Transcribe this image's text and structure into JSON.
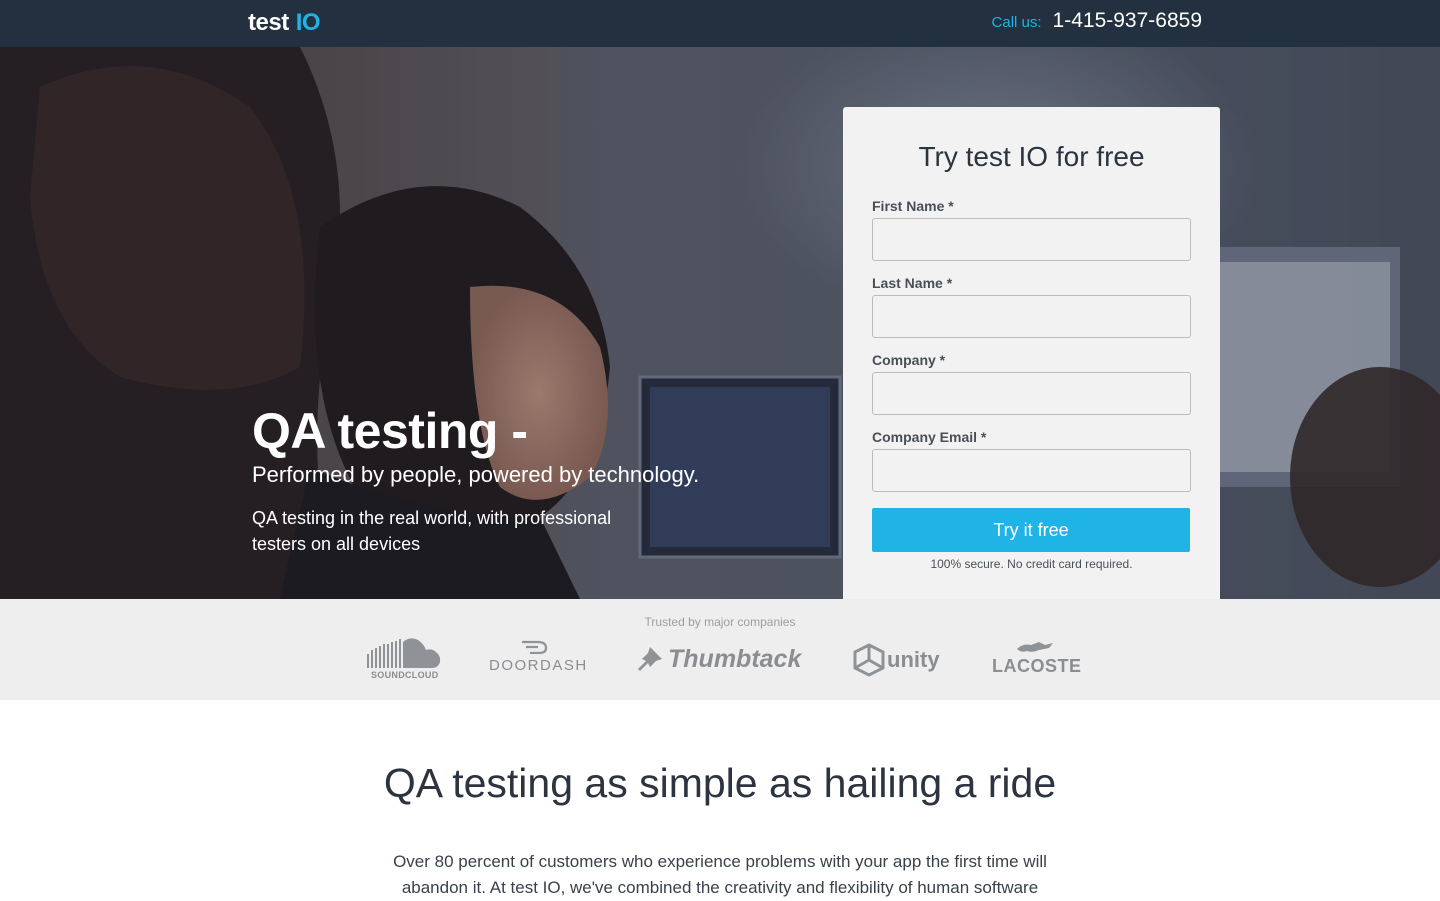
{
  "header": {
    "logo_text_main": "test",
    "logo_text_accent": "IO",
    "call_label": "Call us:",
    "phone": "1-415-937-6859"
  },
  "hero": {
    "title": "QA testing -",
    "subtitle": "Performed by people, powered by technology.",
    "description": "QA testing in the real world, with professional testers on all devices"
  },
  "form": {
    "title": "Try test IO for free",
    "fields": [
      {
        "label": "First Name *",
        "value": "",
        "placeholder": ""
      },
      {
        "label": "Last Name *",
        "value": "",
        "placeholder": ""
      },
      {
        "label": "Company *",
        "value": "",
        "placeholder": ""
      },
      {
        "label": "Company Email *",
        "value": "",
        "placeholder": ""
      }
    ],
    "submit_label": "Try it free",
    "secure_note": "100% secure. No credit card required."
  },
  "trusted": {
    "label": "Trusted by major companies",
    "logos": [
      {
        "name": "SOUNDCLOUD",
        "icon": "soundcloud-logo"
      },
      {
        "name": "DOORDASH",
        "icon": "doordash-logo"
      },
      {
        "name": "Thumbtack",
        "icon": "thumbtack-logo"
      },
      {
        "name": "unity",
        "icon": "unity-logo"
      },
      {
        "name": "LACOSTE",
        "icon": "lacoste-logo"
      }
    ]
  },
  "section": {
    "title": "QA testing as simple as hailing a ride",
    "body": "Over 80 percent of customers who experience problems with your app the first time will abandon it. At test IO, we've combined the creativity and flexibility of human software"
  },
  "colors": {
    "header_bg": "#22303f",
    "accent": "#20b3e6",
    "card_bg": "#f2f2f2",
    "strip_bg": "#eeeeee"
  }
}
